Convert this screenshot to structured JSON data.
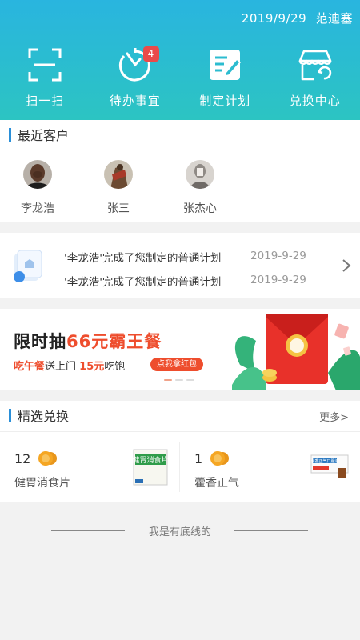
{
  "header": {
    "date": "2019/9/29",
    "user_name": "范迪塞",
    "actions": [
      {
        "label": "扫一扫",
        "icon": "scan-icon"
      },
      {
        "label": "待办事宜",
        "icon": "timer-icon",
        "badge": "4"
      },
      {
        "label": "制定计划",
        "icon": "plan-icon"
      },
      {
        "label": "兑换中心",
        "icon": "store-icon"
      }
    ]
  },
  "recent_customers": {
    "title": "最近客户",
    "items": [
      {
        "name": "李龙浩"
      },
      {
        "name": "张三"
      },
      {
        "name": "张杰心"
      }
    ]
  },
  "notifications": [
    {
      "text": "'李龙浩'完成了您制定的普通计划",
      "date": "2019-9-29"
    },
    {
      "text": "'李龙浩'完成了您制定的普通计划",
      "date": "2019-9-29"
    }
  ],
  "banner": {
    "title_prefix": "限时抽",
    "title_highlight": "66元霸王餐",
    "sub_highlight": "吃午餐",
    "sub_middle": "送上门 ",
    "sub_amount": "15元",
    "sub_end": "吃饱",
    "button": "点我拿红包",
    "active_dot": 0
  },
  "exchange": {
    "title": "精选兑换",
    "more": "更多>",
    "items": [
      {
        "points": "12",
        "name": "健胃消食片",
        "pack_text": "健胃消食片"
      },
      {
        "points": "1",
        "name": "藿香正气",
        "pack_text": "藿香正气口服液"
      }
    ]
  },
  "footer": {
    "text": "我是有底线的"
  },
  "colors": {
    "header_top": "#29b5df",
    "header_bottom": "#2cc4c2",
    "badge": "#ea4a4a",
    "section_bar": "#2a8fd8",
    "promo_red": "#ee4d2d",
    "coin": "#f5a623"
  }
}
